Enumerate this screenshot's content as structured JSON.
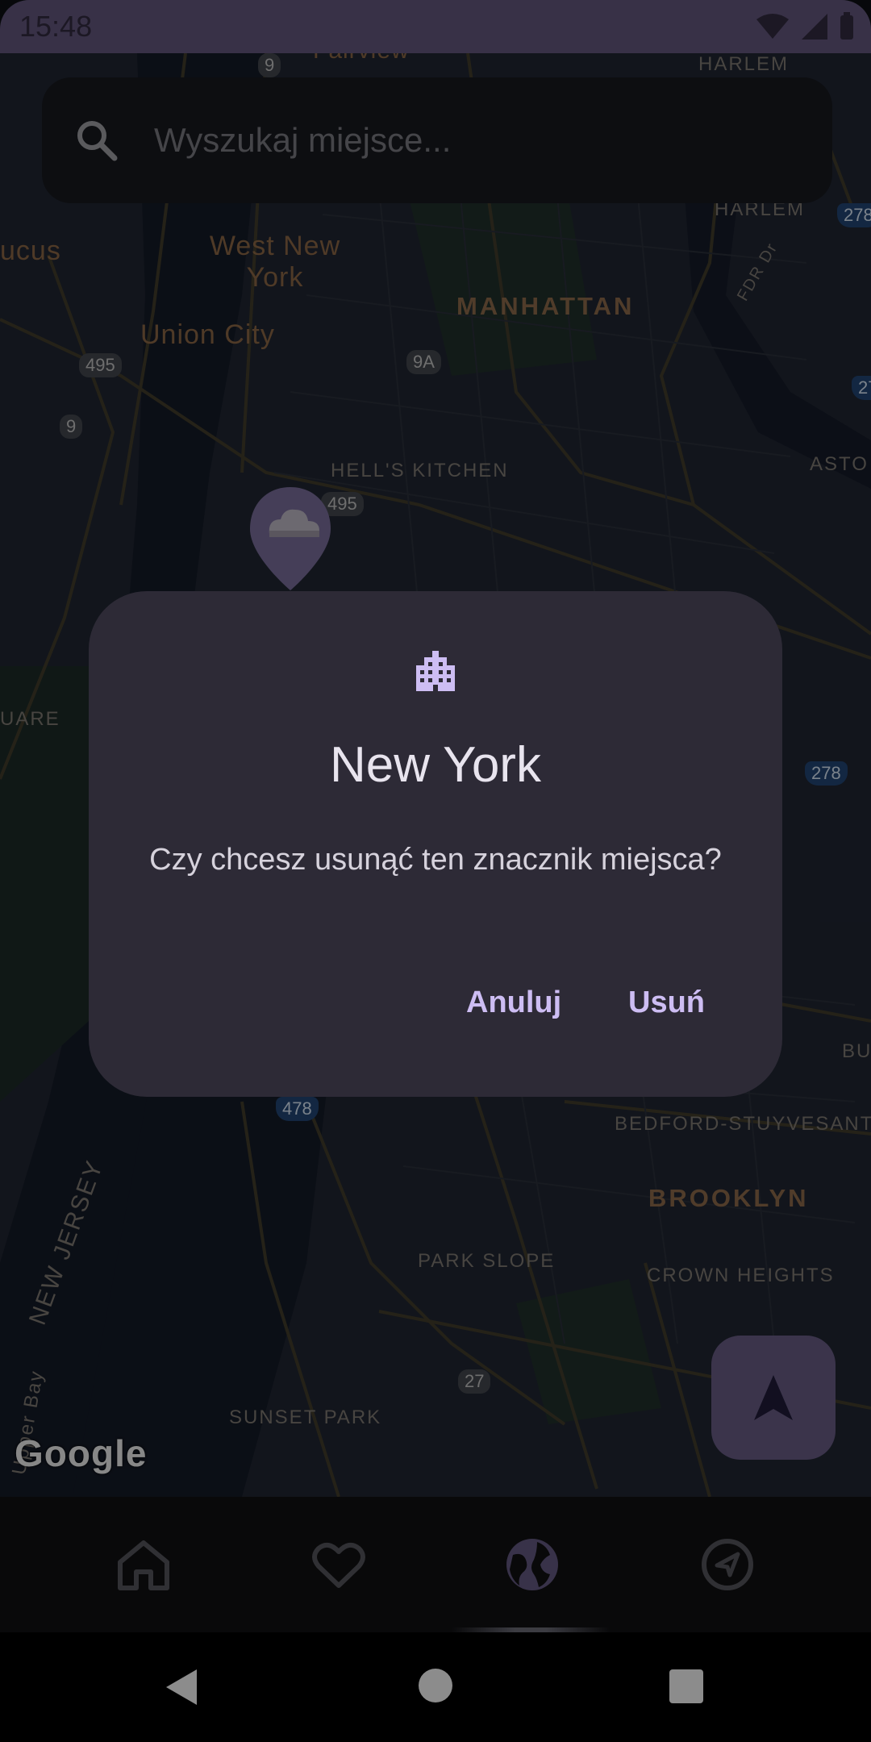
{
  "status_bar": {
    "time": "15:48"
  },
  "search": {
    "placeholder": "Wyszukaj miejsce..."
  },
  "map": {
    "labels": {
      "fairview": "Fairview",
      "harlem_top": "HARLEM",
      "harlem": "HARLEM",
      "west_new_york": "West New\nYork",
      "manhattan": "MANHATTAN",
      "union_city": "Union City",
      "secaucus": "ucus",
      "hells_kitchen": "HELL'S KITCHEN",
      "astoria": "ASTO",
      "square": "UARE",
      "bedford": "BEDFORD-STUYVESANT",
      "brooklyn": "BROOKLYN",
      "park_slope": "PARK SLOPE",
      "crown_heights": "CROWN HEIGHTS",
      "new_jersey": "NEW JERSEY",
      "sunset_park": "SUNSET PARK",
      "upper_bay": "Upper Bay",
      "bu": "BU",
      "fdr": "FDR Dr"
    },
    "shields": {
      "r9_top": "9",
      "r495": "495",
      "r9": "9",
      "r9a": "9A",
      "r495b": "495",
      "r278a": "278",
      "r278b": "278",
      "r27": "27",
      "r478": "478",
      "r27c": "27"
    },
    "attribution": "Google"
  },
  "dialog": {
    "icon": "apartment-icon",
    "title": "New York",
    "message": "Czy chcesz usunąć ten znacznik miejsca?",
    "cancel_label": "Anuluj",
    "delete_label": "Usuń"
  },
  "bottom_nav": {
    "items": [
      {
        "icon": "home-icon",
        "selected": false
      },
      {
        "icon": "heart-icon",
        "selected": false
      },
      {
        "icon": "globe-icon",
        "selected": true
      },
      {
        "icon": "navigation-icon",
        "selected": false
      }
    ]
  },
  "colors": {
    "accent": "#cdbdf3",
    "dialog_bg": "#2d2a36",
    "status_bar": "#574c6d",
    "fab": "#5b5174"
  }
}
